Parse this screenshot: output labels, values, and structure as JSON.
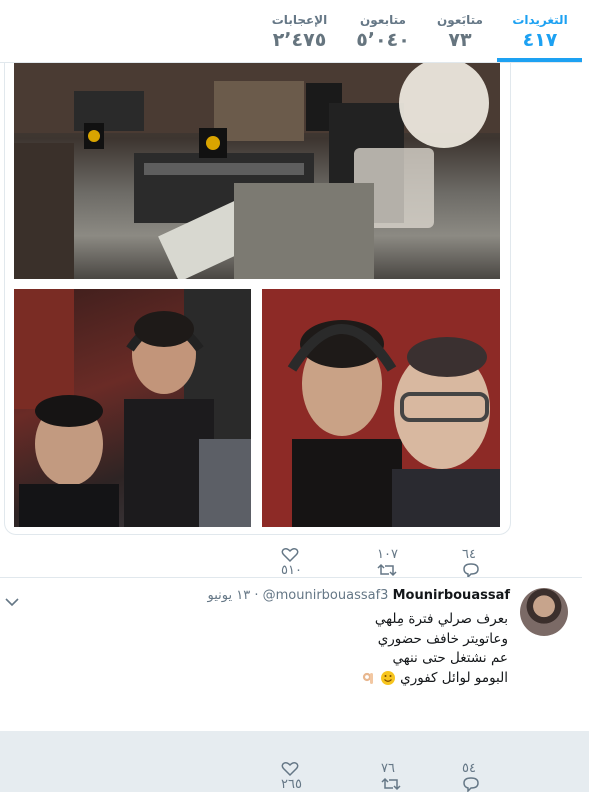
{
  "stats": [
    {
      "label": "التغريدات",
      "value": "٤١٧",
      "active": true
    },
    {
      "label": "متابَعون",
      "value": "٧٣",
      "active": false
    },
    {
      "label": "متابعون",
      "value": "٥٬٠٤٠",
      "active": false
    },
    {
      "label": "الإعجابات",
      "value": "٢٬٤٧٥",
      "active": false
    }
  ],
  "tweet1": {
    "replies": "٦٤",
    "retweets": "١٠٧",
    "likes": "٥١٠"
  },
  "tweet2": {
    "name": "Mounirbouassaf",
    "handle": "@mounirbouassaf3",
    "date": "١٣ يونيو",
    "lines": [
      "بعرف صرلي فترة مِلهي",
      "وعاتويتر خافف حضوري",
      "عم نشتغل حتى ننهي",
      "البومو لوائل كفوري"
    ],
    "replies": "٥٤",
    "retweets": "٧٦",
    "likes": "٢٦٥"
  },
  "colors": {
    "accent": "#1da1f2",
    "muted": "#657786"
  }
}
